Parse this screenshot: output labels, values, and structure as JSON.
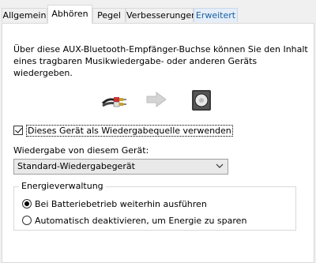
{
  "tabs": [
    {
      "label": "Allgemein"
    },
    {
      "label": "Abhören"
    },
    {
      "label": "Pegel"
    },
    {
      "label": "Verbesserungen"
    },
    {
      "label": "Erweitert"
    }
  ],
  "active_tab": "Abhören",
  "description": {
    "line1": "Über diese AUX-Bluetooth-Empfänger-Buchse können Sie den Inhalt",
    "line2": "eines tragbaren Musikwiedergabe- oder anderen Geräts",
    "line3": "wiedergeben."
  },
  "icons": {
    "source": "audio-cable-icon",
    "arrow": "right-arrow-icon",
    "target": "speaker-icon"
  },
  "listen_checkbox": {
    "label": "Dieses Gerät als Wiedergabequelle verwenden",
    "checked": true
  },
  "playback": {
    "label": "Wiedergabe von diesem Gerät:",
    "selected": "Standard-Wiedergabegerät"
  },
  "power": {
    "title": "Energieverwaltung",
    "options": [
      {
        "label": "Bei Batteriebetrieb weiterhin ausführen",
        "selected": true
      },
      {
        "label": "Automatisch deaktivieren, um Energie zu sparen",
        "selected": false
      }
    ]
  }
}
